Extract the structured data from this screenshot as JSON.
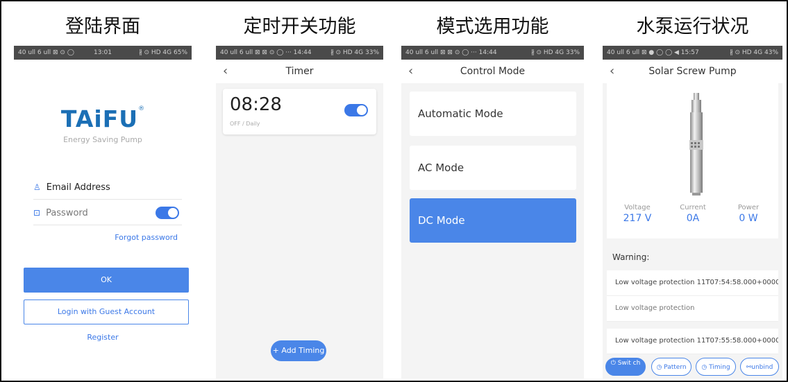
{
  "panel_titles": [
    "登陆界面",
    "定时开关功能",
    "模式选用功能",
    "水泵运行状况"
  ],
  "p1": {
    "status_left": "40 ull 6 ull ⊠ ⊙ ◯",
    "status_time": "13:01",
    "status_right": "∦ ⊙ HD 4G 65%",
    "brand": "TAiFU",
    "brand_reg": "®",
    "tagline": "Energy Saving Pump",
    "email_placeholder": "Email Address",
    "password_placeholder": "Password",
    "forgot": "Forgot password",
    "ok": "OK",
    "guest": "Login with Guest Account",
    "register": "Register"
  },
  "p2": {
    "status_left": "40 ull 6 ull ⊠ ⊠ ⊙ ◯ ··· 14:44",
    "status_right": "∦ ⊙ HD 4G 33%",
    "title": "Timer",
    "timer_time": "08:28",
    "timer_repeat": "OFF / Daily",
    "add_timing": "+ Add Timing"
  },
  "p3": {
    "status_left": "40 ull 6 ull ⊠ ⊠ ⊙ ◯ ··· 14:44",
    "status_right": "∦ ⊙ HD 4G 33%",
    "title": "Control Mode",
    "modes": [
      "Automatic Mode",
      "AC Mode",
      "DC Mode"
    ],
    "active_mode": "DC Mode"
  },
  "p4": {
    "status_left": "40 ull 6 ull ⊠ ● ◯ ◯ ◀ 15:57",
    "status_right": "∦ ⊙ HD 4G 43%",
    "title": "Solar Screw Pump",
    "metrics": [
      {
        "label": "Voltage",
        "value": "217 V"
      },
      {
        "label": "Current",
        "value": "0A"
      },
      {
        "label": "Power",
        "value": "0 W"
      }
    ],
    "warning_title": "Warning:",
    "warnings": [
      {
        "text": "Low voltage protection 11T07:54:58.000+0000",
        "detail": "Low voltage protection"
      },
      {
        "text": "Low voltage protection 11T07:55:58.000+0000"
      }
    ],
    "buttons": {
      "switch": "Swit ch",
      "pattern": "Pattern",
      "timing": "Timing",
      "unbind": "unbind"
    }
  },
  "colors": {
    "accent": "#4a86e8",
    "brand": "#1b6fb5"
  }
}
